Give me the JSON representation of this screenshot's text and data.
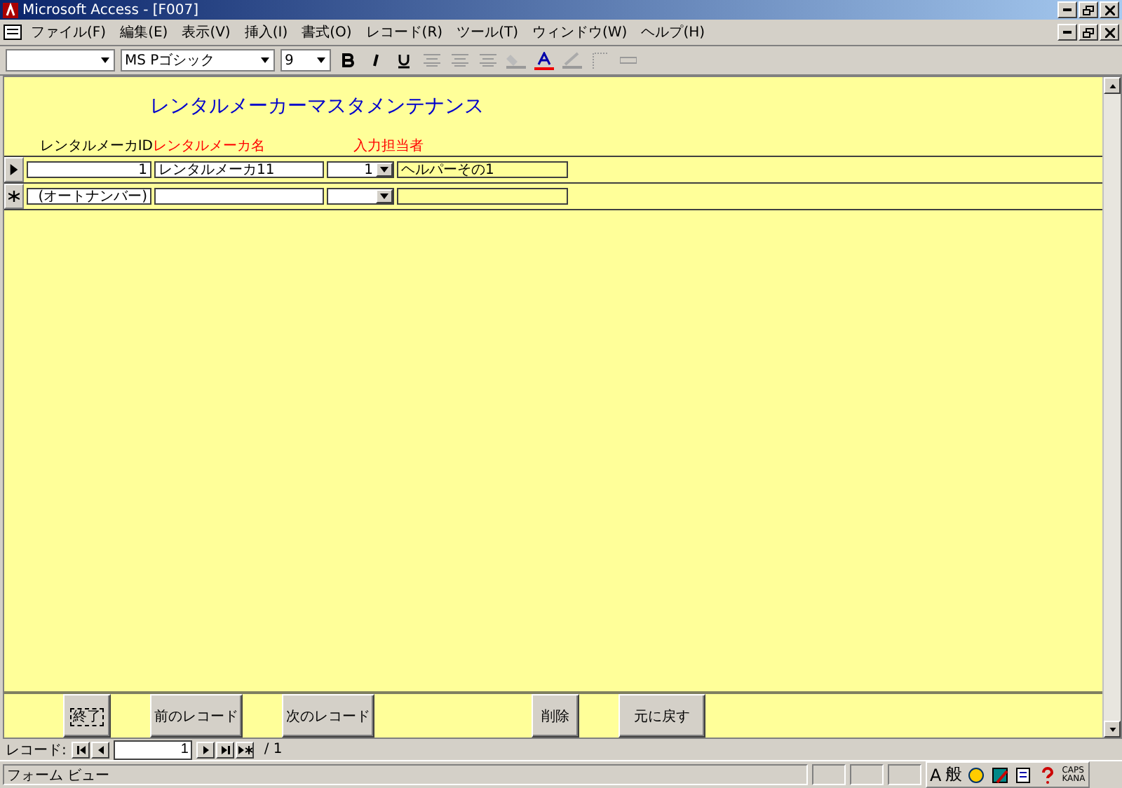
{
  "window": {
    "title": "Microsoft Access - [F007]"
  },
  "menu": [
    "ファイル(F)",
    "編集(E)",
    "表示(V)",
    "挿入(I)",
    "書式(O)",
    "レコード(R)",
    "ツール(T)",
    "ウィンドウ(W)",
    "ヘルプ(H)"
  ],
  "toolbar": {
    "font_name": "MS Pゴシック",
    "font_size": "9"
  },
  "form": {
    "title": "レンタルメーカーマスタメンテナンス",
    "columns": [
      {
        "label": "レンタルメーカID",
        "required": false
      },
      {
        "label": "レンタルメーカ名",
        "required": true
      },
      {
        "label": "入力担当者",
        "required": true
      }
    ],
    "rows": [
      {
        "kind": "record",
        "selected": true,
        "id": "1",
        "name": "レンタルメーカ11",
        "staff_id": "1",
        "staff_name": "ヘルパーその1"
      },
      {
        "kind": "new",
        "selected": false,
        "id": "(オートナンバー)",
        "name": "",
        "staff_id": "",
        "staff_name": ""
      }
    ],
    "buttons": [
      {
        "label": "終了",
        "focused": true
      },
      {
        "label": "前のレコード",
        "focused": false
      },
      {
        "label": "次のレコード",
        "focused": false
      },
      {
        "label": "削除",
        "focused": false
      },
      {
        "label": "元に戻す",
        "focused": false
      }
    ]
  },
  "navigation": {
    "label": "レコード:",
    "current": "1",
    "total": "/ 1"
  },
  "status_bar": {
    "text": "フォーム ビュー",
    "ime": [
      "A",
      "般"
    ],
    "caps": "CAPS",
    "kana": "KANA"
  }
}
